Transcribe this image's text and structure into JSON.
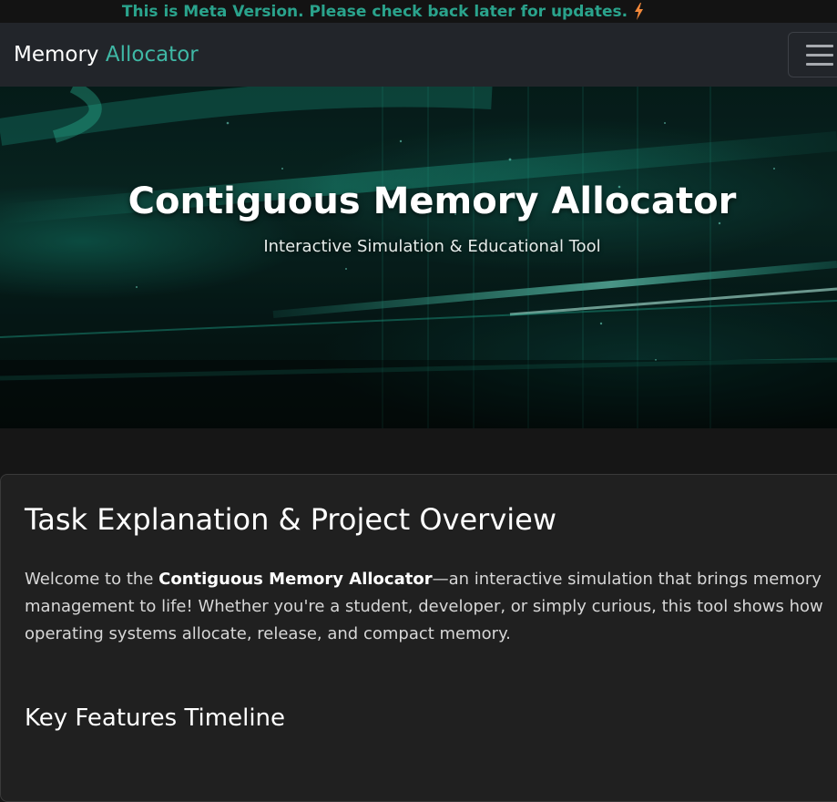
{
  "announcement": {
    "text": "This is Meta Version. Please check back later for updates.",
    "icon": "lightning-bolt-icon",
    "color": "#2aa38c",
    "icon_color": "#f2883a"
  },
  "navbar": {
    "brand_primary": "Memory",
    "brand_accent": "Allocator",
    "accent_color": "#3fb8a5",
    "menu_icon": "hamburger-menu-icon"
  },
  "hero": {
    "title": "Contiguous Memory Allocator",
    "subtitle": "Interactive Simulation & Educational Tool"
  },
  "overview": {
    "title": "Task Explanation & Project Overview",
    "intro_prefix": "Welcome to the ",
    "intro_bold": "Contiguous Memory Allocator",
    "intro_suffix": "—an interactive simulation that brings memory management to life! Whether you're a student, developer, or simply curious, this tool shows how operating systems allocate, release, and compact memory.",
    "features_title": "Key Features Timeline"
  }
}
